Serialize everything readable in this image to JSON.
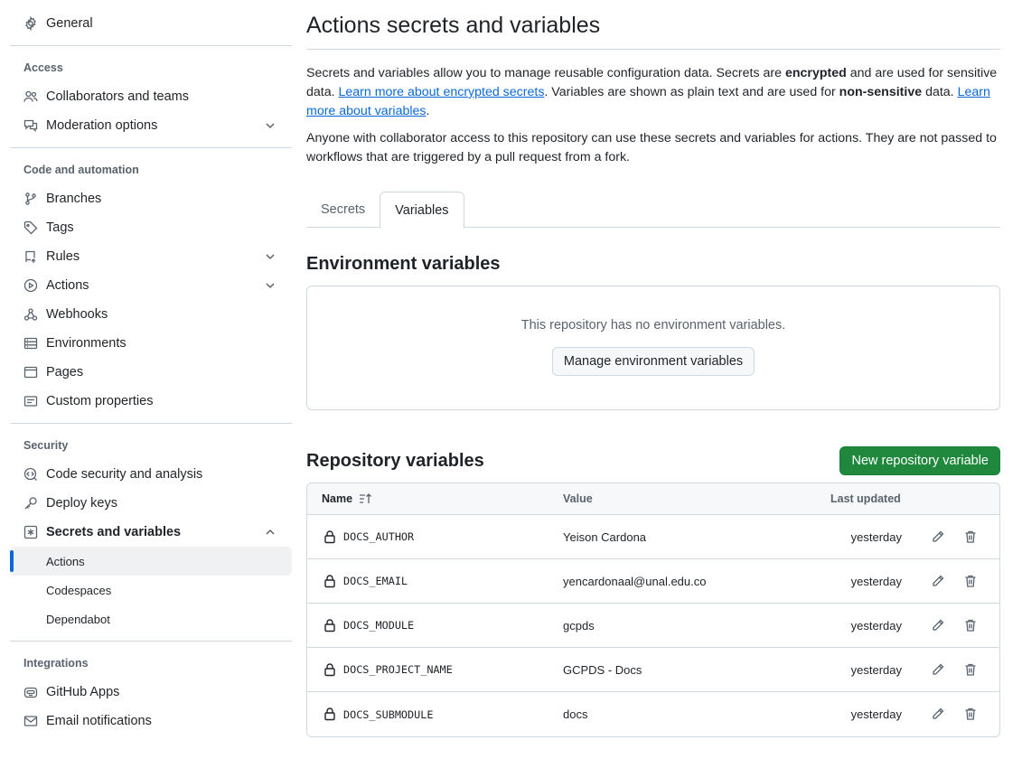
{
  "sidebar": {
    "general": "General",
    "sections": {
      "access": "Access",
      "code": "Code and automation",
      "security": "Security",
      "integrations": "Integrations"
    },
    "items": {
      "collaborators": "Collaborators and teams",
      "moderation": "Moderation options",
      "branches": "Branches",
      "tags": "Tags",
      "rules": "Rules",
      "actions": "Actions",
      "webhooks": "Webhooks",
      "environments": "Environments",
      "pages": "Pages",
      "custom_properties": "Custom properties",
      "code_security": "Code security and analysis",
      "deploy_keys": "Deploy keys",
      "secrets_vars": "Secrets and variables",
      "github_apps": "GitHub Apps",
      "email_notifications": "Email notifications"
    },
    "sub_items": {
      "actions": "Actions",
      "codespaces": "Codespaces",
      "dependabot": "Dependabot"
    }
  },
  "main": {
    "title": "Actions secrets and variables",
    "desc1": {
      "p1": "Secrets and variables allow you to manage reusable configuration data. Secrets are ",
      "b1": "encrypted",
      "p2": " and are used for sensitive data. ",
      "link1": "Learn more about encrypted secrets",
      "p3": ". Variables are shown as plain text and are used for ",
      "b2": "non-sensitive",
      "p4": " data. ",
      "link2": "Learn more about variables",
      "p5": "."
    },
    "desc2": "Anyone with collaborator access to this repository can use these secrets and variables for actions. They are not passed to workflows that are triggered by a pull request from a fork.",
    "tabs": [
      "Secrets",
      "Variables"
    ],
    "selected_tab": "Variables",
    "env": {
      "heading": "Environment variables",
      "empty": "This repository has no environment variables.",
      "manage_button": "Manage environment variables"
    },
    "repo": {
      "heading": "Repository variables",
      "new_button": "New repository variable",
      "columns": {
        "name": "Name",
        "value": "Value",
        "updated": "Last updated"
      },
      "rows": [
        {
          "name": "DOCS_AUTHOR",
          "value": "Yeison Cardona",
          "updated": "yesterday"
        },
        {
          "name": "DOCS_EMAIL",
          "value": "yencardonaal@unal.edu.co",
          "updated": "yesterday"
        },
        {
          "name": "DOCS_MODULE",
          "value": "gcpds",
          "updated": "yesterday"
        },
        {
          "name": "DOCS_PROJECT_NAME",
          "value": "GCPDS - Docs",
          "updated": "yesterday"
        },
        {
          "name": "DOCS_SUBMODULE",
          "value": "docs",
          "updated": "yesterday"
        }
      ]
    }
  },
  "colors": {
    "accent": "#0969da",
    "primary_button": "#1f883d",
    "muted_text": "#59636e",
    "border": "#d1d9e0"
  },
  "icons": {
    "general": "gear-icon",
    "collaborators": "people-icon",
    "moderation": "comment-discussion-icon",
    "branches": "git-branch-icon",
    "tags": "tag-icon",
    "rules": "repo-push-icon",
    "actions": "play-icon",
    "webhooks": "webhook-icon",
    "environments": "server-icon",
    "pages": "browser-icon",
    "custom_properties": "note-icon",
    "code_security": "codescan-icon",
    "deploy_keys": "key-icon",
    "secrets_vars": "key-asterisk-icon",
    "github_apps": "hubot-icon",
    "email_notifications": "mail-icon",
    "row_lock": "lock-icon",
    "row_edit": "pencil-icon",
    "row_delete": "trash-icon",
    "sort": "sort-asc-icon"
  }
}
